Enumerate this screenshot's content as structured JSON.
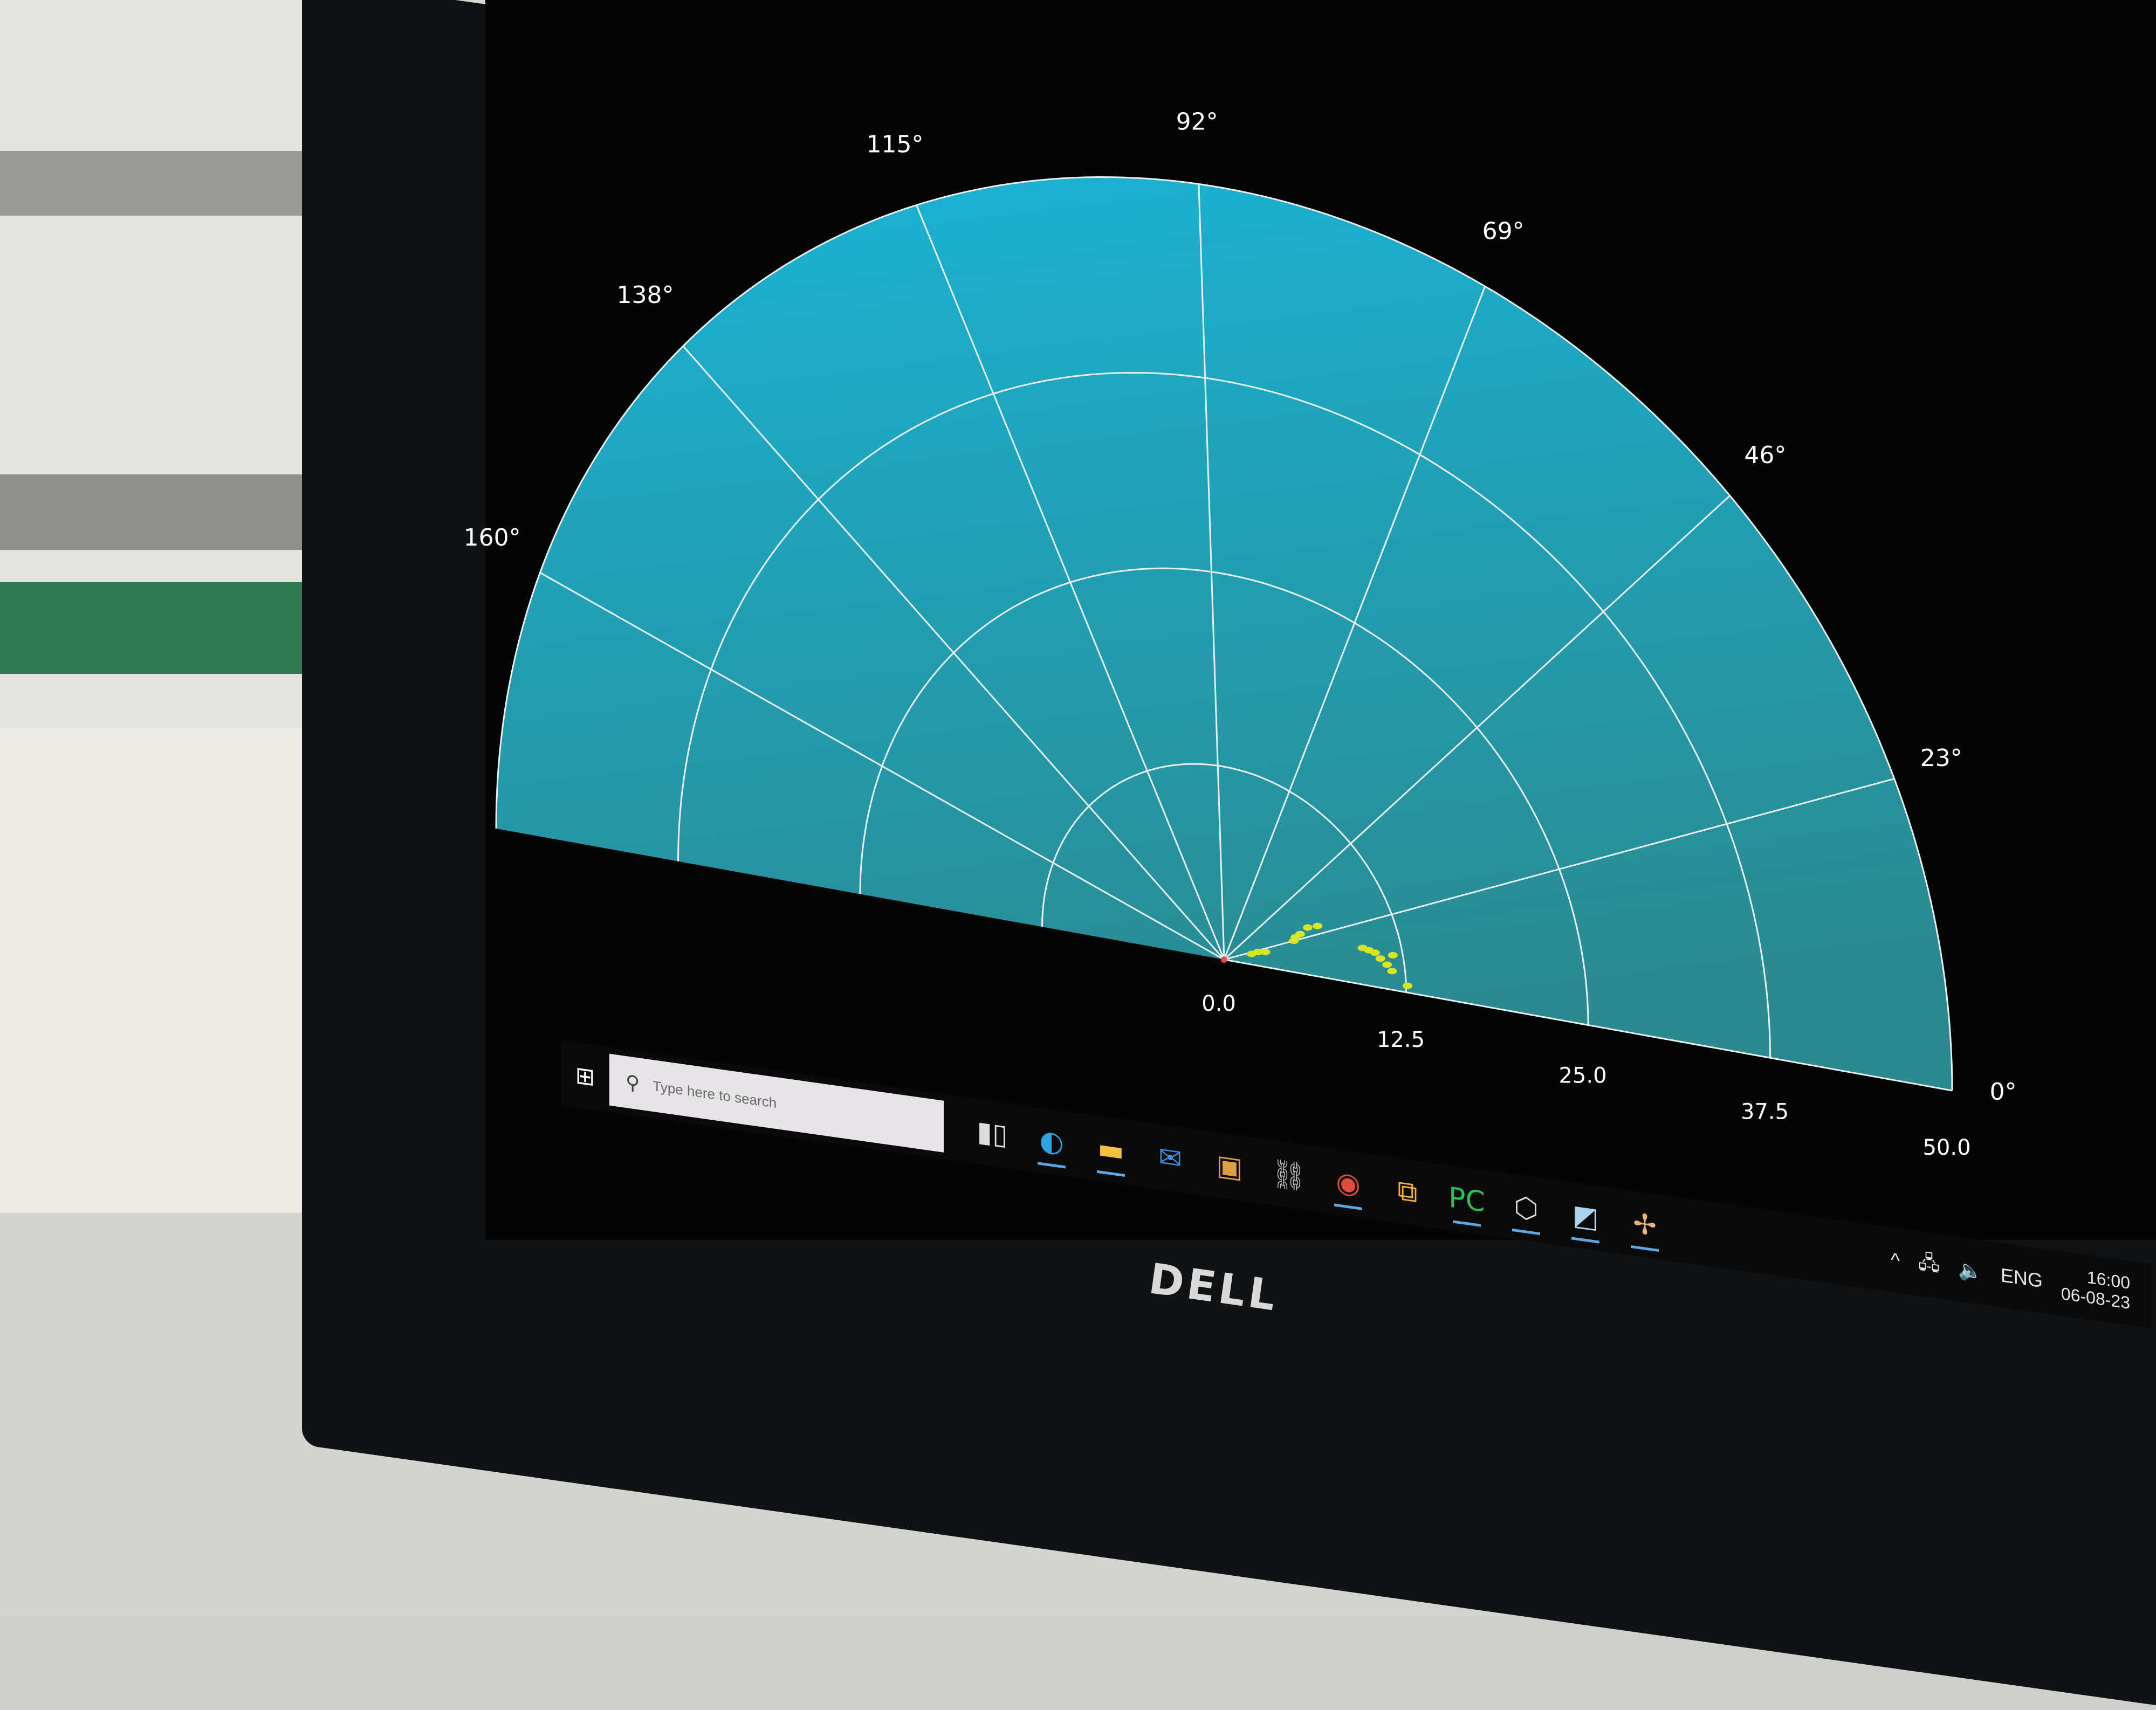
{
  "chart_data": {
    "type": "scatter",
    "projection": "polar",
    "theta_range_deg": [
      0,
      180
    ],
    "r_range": [
      0,
      50.0
    ],
    "r_ticks": [
      "0.0",
      "12.5",
      "25.0",
      "37.5",
      "50.0"
    ],
    "theta_ticks_deg": [
      0,
      23,
      46,
      69,
      92,
      115,
      138,
      160
    ],
    "theta_tick_labels": [
      "0°",
      "23°",
      "46°",
      "69°",
      "92°",
      "115°",
      "138°",
      "160°"
    ],
    "grid": true,
    "background_colors": [
      "#1ab3d6",
      "#2a8a8f"
    ],
    "point_color": "#d7e61e",
    "points": [
      {
        "theta_deg": 20,
        "r": 2.0
      },
      {
        "theta_deg": 21,
        "r": 2.5
      },
      {
        "theta_deg": 19,
        "r": 3.0
      },
      {
        "theta_deg": 23,
        "r": 5.2
      },
      {
        "theta_deg": 25,
        "r": 5.4
      },
      {
        "theta_deg": 26,
        "r": 5.8
      },
      {
        "theta_deg": 28,
        "r": 6.5
      },
      {
        "theta_deg": 27,
        "r": 7.2
      },
      {
        "theta_deg": 14,
        "r": 9.8
      },
      {
        "theta_deg": 13,
        "r": 10.2
      },
      {
        "theta_deg": 12,
        "r": 10.6
      },
      {
        "theta_deg": 10,
        "r": 10.9
      },
      {
        "theta_deg": 8,
        "r": 11.3
      },
      {
        "theta_deg": 6,
        "r": 11.6
      },
      {
        "theta_deg": 11,
        "r": 11.8
      },
      {
        "theta_deg": 2,
        "r": 12.6
      }
    ]
  },
  "taskbar": {
    "search_placeholder": "Type here to search",
    "apps": [
      {
        "icon": "task-view-icon",
        "glyph": "▮▯"
      },
      {
        "icon": "edge-icon",
        "glyph": "◐"
      },
      {
        "icon": "file-explorer-icon",
        "glyph": "▬"
      },
      {
        "icon": "mail-icon",
        "glyph": "✉"
      },
      {
        "icon": "store-icon",
        "glyph": "▣"
      },
      {
        "icon": "network-app-icon",
        "glyph": "⛓"
      },
      {
        "icon": "chrome-icon",
        "glyph": "◉"
      },
      {
        "icon": "remote-desktop-icon",
        "glyph": "⧉"
      },
      {
        "icon": "pycharm-icon",
        "glyph": "PC"
      },
      {
        "icon": "virtualbox-icon",
        "glyph": "⬡"
      },
      {
        "icon": "app-window-icon",
        "glyph": "◩"
      },
      {
        "icon": "matplotlib-figure-icon",
        "glyph": "✢"
      }
    ],
    "tray": {
      "chevron": "^",
      "language": "ENG",
      "time": "16:00",
      "date": "06-08-23"
    }
  },
  "brand": "DELL",
  "colors": {
    "taskbar_bg": "#0a0a0a",
    "search_bg": "#e7e4e8",
    "grid_line": "#e8eef0"
  }
}
